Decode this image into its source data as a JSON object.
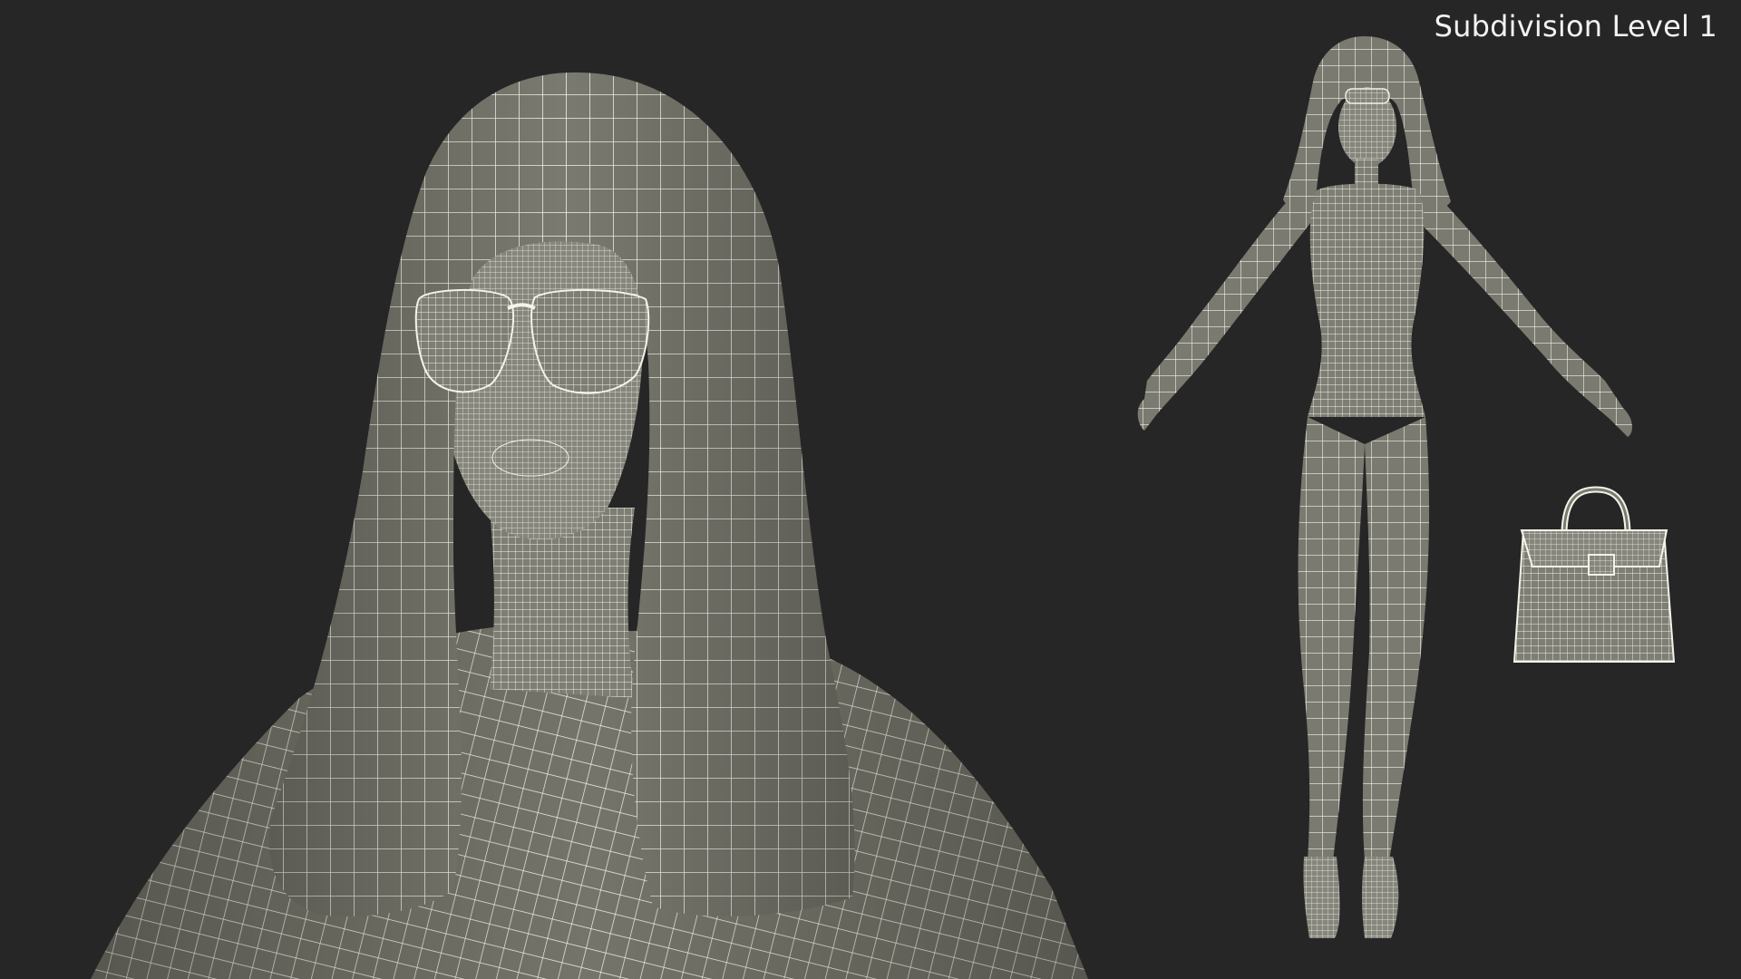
{
  "overlay": {
    "label": "Subdivision Level 1"
  },
  "scene": {
    "background_color": "#262626",
    "surface_color": "#7a7a70",
    "surface_shadow_color": "#5f5f57",
    "wire_color": "#f4f3ea",
    "content": [
      "close-up wireframe head with long hair and sunglasses",
      "full-body wireframe figure in A-pose",
      "wireframe handbag"
    ]
  }
}
